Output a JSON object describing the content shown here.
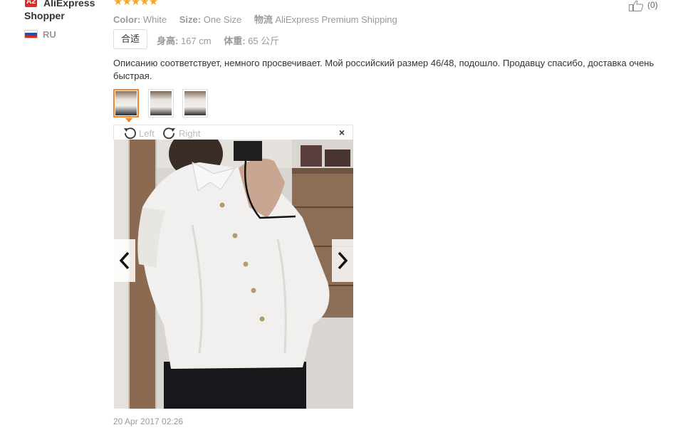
{
  "user": {
    "badge": "A2",
    "name_line1": "AliExpress",
    "name_line2": "Shopper",
    "country": "RU",
    "flag_colors": [
      "#ffffff",
      "#1c52b4",
      "#d52b1e"
    ]
  },
  "rating": {
    "stars": 5,
    "glyphs": "★★★★★"
  },
  "helpful": {
    "icon": "thumbs-up-icon",
    "count": "(0)"
  },
  "attributes": [
    {
      "label": "Color:",
      "value": "White"
    },
    {
      "label": "Size:",
      "value": "One Size"
    },
    {
      "label": "物流",
      "value": "AliExpress Premium Shipping"
    }
  ],
  "fit": {
    "label": "合适"
  },
  "measures": [
    {
      "label": "身高:",
      "value": "167 cm"
    },
    {
      "label": "体重:",
      "value": "65 公斤"
    }
  ],
  "review_text": "Описанию соответствует, немного просвечивает. Мой российский размер 46/48, подошло. Продавцу спасибо, доставка очень быстрая.",
  "thumbnails": {
    "count": 3,
    "selected_index": 0
  },
  "viewer": {
    "rotate_left": "Left",
    "rotate_right": "Right",
    "close": "×",
    "prev": "‹",
    "next": "›"
  },
  "date": "20 Apr 2017 02:26",
  "colors": {
    "accent": "#f0852d",
    "star": "#f5a623",
    "badge": "#e02b27"
  }
}
